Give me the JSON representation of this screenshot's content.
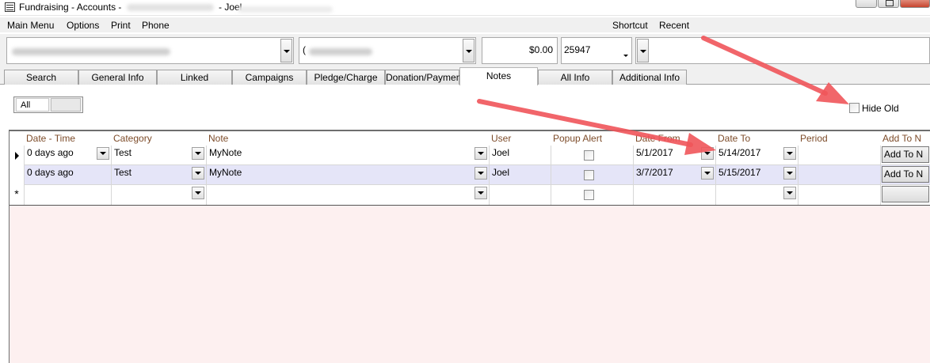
{
  "window": {
    "title": "Fundraising - Accounts -",
    "user": "- Joel"
  },
  "menu": {
    "items": [
      "Main Menu",
      "Options",
      "Print",
      "Phone"
    ],
    "shortcut": "Shortcut",
    "recent": "Recent"
  },
  "account": {
    "phone_prefix": "(",
    "balance": "$0.00",
    "account_number": "25947"
  },
  "tabs": [
    "Search",
    "General Info",
    "Linked",
    "Campaigns",
    "Pledge/Charge",
    "Donation/Payment",
    "Notes",
    "All Info",
    "Additional Info"
  ],
  "active_tab": "Notes",
  "filter": {
    "all_label": "All",
    "hide_old_label": "Hide Old"
  },
  "grid": {
    "columns": [
      "Date - Time",
      "Category",
      "Note",
      "User",
      "Popup Alert",
      "Date From",
      "Date To",
      "Period",
      "Add To N"
    ],
    "rows": [
      {
        "date_time": "0 days ago",
        "category": "Test",
        "note": "MyNote",
        "user": "Joel",
        "popup_alert": false,
        "date_from": "5/1/2017",
        "date_to": "5/14/2017",
        "period": "",
        "add_to": "Add To N"
      },
      {
        "date_time": "0 days ago",
        "category": "Test",
        "note": "MyNote",
        "user": "Joel",
        "popup_alert": false,
        "date_from": "3/7/2017",
        "date_to": "5/15/2017",
        "period": "",
        "add_to": "Add To N"
      }
    ]
  },
  "colors": {
    "header_text": "#7d4c2a",
    "alt_row": "#e5e5f8",
    "empty_area": "#fdf0f0",
    "annotation_arrow": "#f0555a"
  }
}
